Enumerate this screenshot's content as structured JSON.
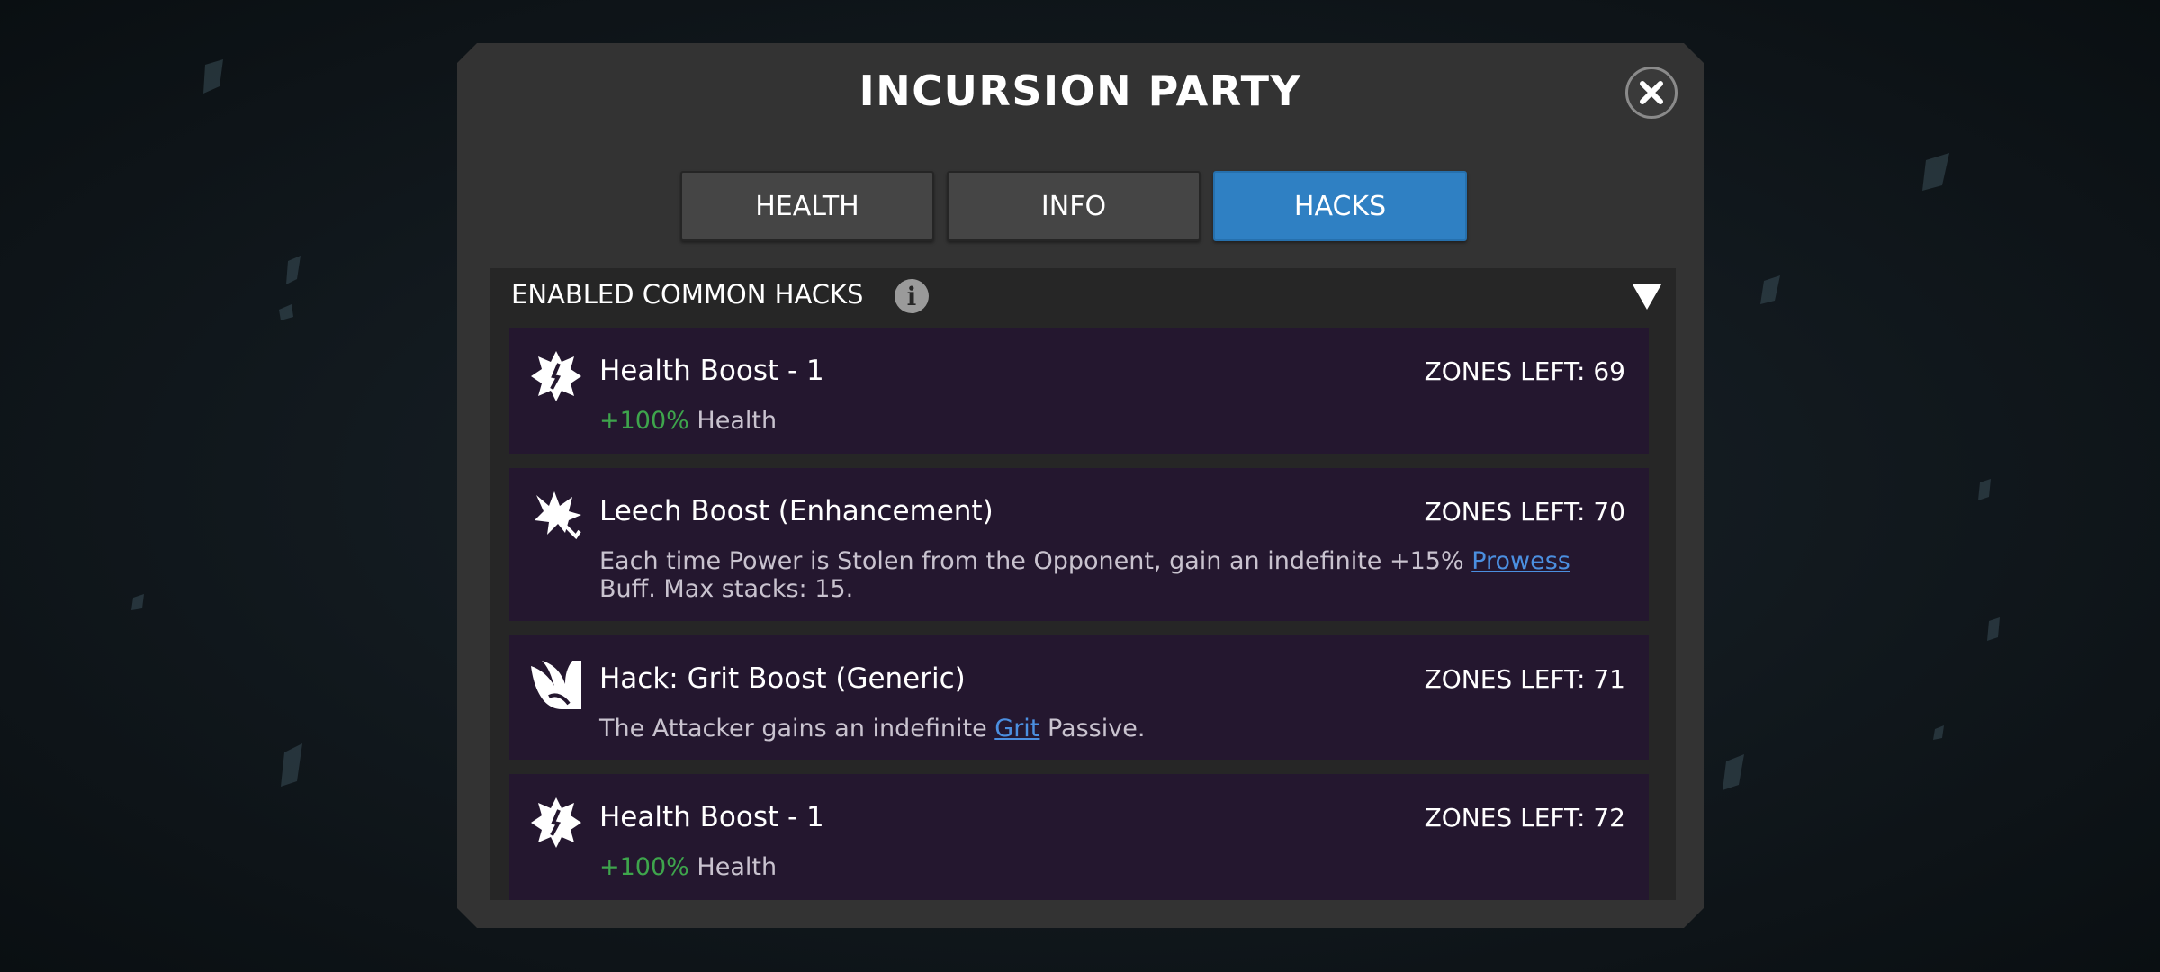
{
  "dialog": {
    "title": "INCURSION PARTY",
    "close_icon": "close-x-circle"
  },
  "tabs": [
    {
      "label": "HEALTH",
      "active": false
    },
    {
      "label": "INFO",
      "active": false
    },
    {
      "label": "HACKS",
      "active": true
    }
  ],
  "section": {
    "title": "ENABLED COMMON HACKS",
    "info_icon": "i",
    "collapse_icon": "triangle-down"
  },
  "hacks": [
    {
      "icon": "health-boost-burst",
      "name": "Health Boost - 1",
      "zones": "ZONES LEFT: 69",
      "desc_bonus": "+100%",
      "desc_text": " Health"
    },
    {
      "icon": "leech-boost-burst",
      "name": "Leech Boost (Enhancement)",
      "zones": "ZONES LEFT: 70",
      "desc_pre": "Each time Power is Stolen from the Opponent, gain an indefinite +15% ",
      "desc_link": "Prowess",
      "desc_post": " Buff. Max stacks: 15."
    },
    {
      "icon": "grit-boost-flame",
      "name": "Hack: Grit Boost (Generic)",
      "zones": "ZONES LEFT: 71",
      "desc_pre": "The Attacker gains an indefinite ",
      "desc_link": "Grit",
      "desc_post": " Passive."
    },
    {
      "icon": "health-boost-burst",
      "name": "Health Boost - 1",
      "zones": "ZONES LEFT: 72",
      "desc_bonus": "+100%",
      "desc_text": " Health"
    }
  ],
  "colors": {
    "panel": "#333333",
    "active_tab": "#2f80c3",
    "hack_row": "#24172f",
    "bonus_green": "#3ea54c",
    "link_blue": "#4b8fe0"
  }
}
